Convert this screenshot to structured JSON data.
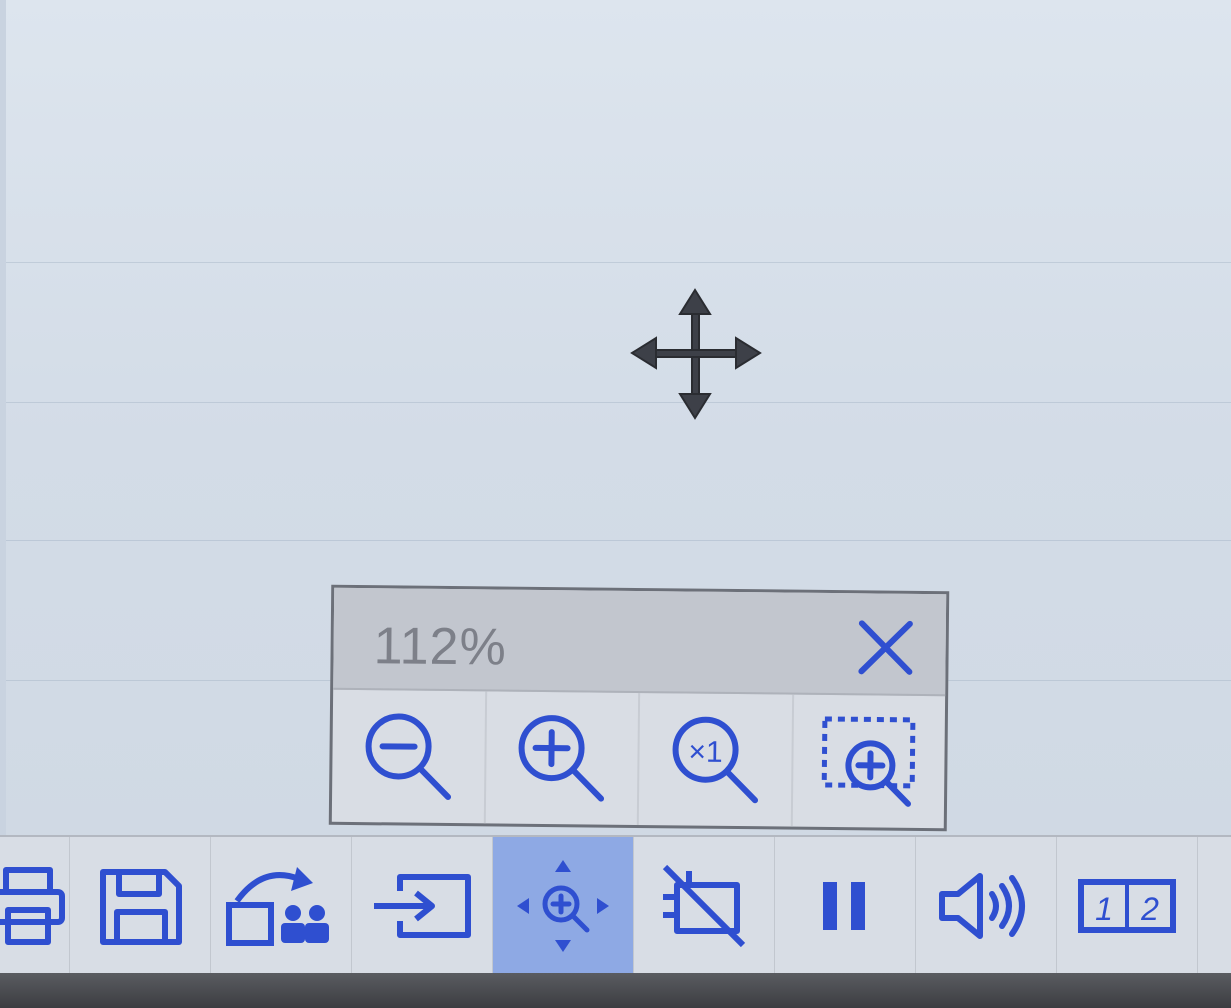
{
  "zoom_panel": {
    "level": "112%",
    "buttons": [
      {
        "icon": "zoom-out-icon"
      },
      {
        "icon": "zoom-in-icon"
      },
      {
        "icon": "zoom-reset-icon",
        "label": "×1"
      },
      {
        "icon": "zoom-area-icon"
      }
    ],
    "close_icon": "close-icon"
  },
  "cursor": {
    "icon": "move-cursor-icon"
  },
  "toolbar": {
    "buttons": [
      {
        "icon": "print-icon"
      },
      {
        "icon": "save-icon"
      },
      {
        "icon": "share-icon"
      },
      {
        "icon": "input-source-icon"
      },
      {
        "icon": "pan-zoom-icon",
        "active": true
      },
      {
        "icon": "hide-screen-icon"
      },
      {
        "icon": "pause-icon"
      },
      {
        "icon": "volume-icon"
      },
      {
        "icon": "split-screen-icon",
        "labels": [
          "1",
          "2"
        ]
      }
    ]
  },
  "colors": {
    "icon": "#2f4fd0",
    "active_bg": "#8ea9e4",
    "screen_bg": "#d6dee8"
  }
}
